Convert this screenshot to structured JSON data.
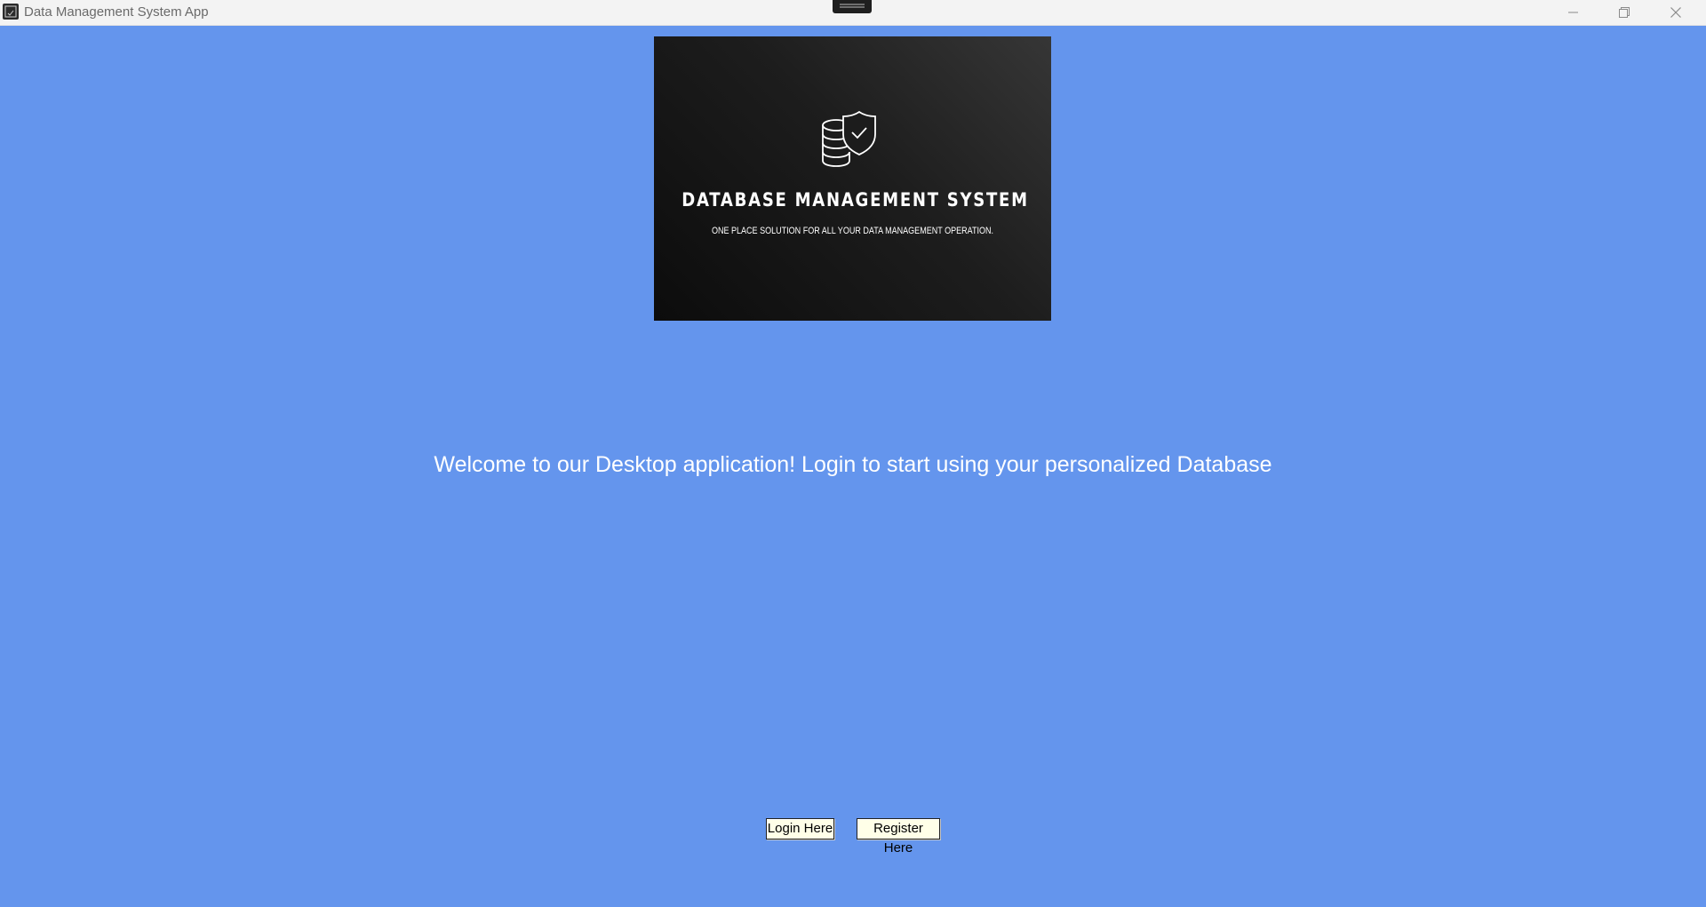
{
  "window": {
    "title": "Data Management System App",
    "icons": {
      "app": "app-icon",
      "snap": "snap-layout-handle-icon",
      "minimize": "minimize-icon",
      "maximize": "restore-icon",
      "close": "close-icon"
    }
  },
  "banner": {
    "title": "DATABASE MANAGEMENT SYSTEM",
    "subtitle": "ONE PLACE SOLUTION FOR ALL YOUR DATA MANAGEMENT OPERATION.",
    "logo_icon": "database-shield-check-icon"
  },
  "main": {
    "welcome_text": "Welcome to our Desktop application! Login to start using your personalized Database"
  },
  "actions": {
    "login_label": "Login Here",
    "register_label": "Register Here"
  },
  "colors": {
    "background": "#6495ed",
    "titlebar": "#f3f3f3",
    "banner_dark": "#1d1d1d",
    "button_face": "#ffffe8"
  }
}
